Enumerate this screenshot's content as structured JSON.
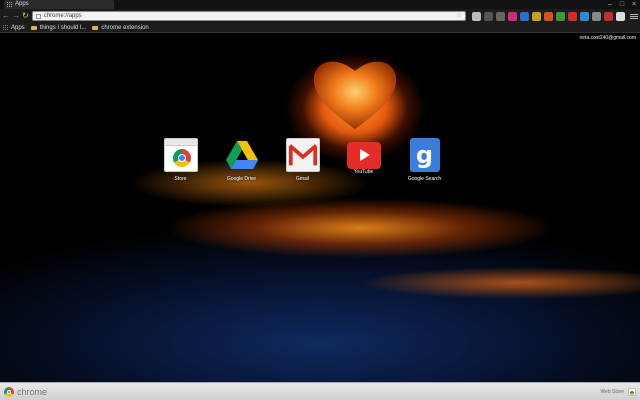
{
  "tab": {
    "title": "Apps"
  },
  "window_controls": {
    "minimize": "–",
    "maximize": "□",
    "close": "×"
  },
  "toolbar": {
    "back": "←",
    "forward": "→",
    "reload": "↻",
    "url": "chrome://apps",
    "star": "☆",
    "extensions": [
      {
        "name": "ext-icon-1",
        "color": "#bbbbbb",
        "glyph": ""
      },
      {
        "name": "ext-icon-2",
        "color": "#555555",
        "glyph": ""
      },
      {
        "name": "ext-icon-3",
        "color": "#666666",
        "glyph": ""
      },
      {
        "name": "ext-icon-4",
        "color": "#d42a7a",
        "glyph": ""
      },
      {
        "name": "ext-icon-5",
        "color": "#2a6fd4",
        "glyph": ""
      },
      {
        "name": "ext-icon-6",
        "color": "#c8a020",
        "glyph": ""
      },
      {
        "name": "ext-icon-7",
        "color": "#d85020",
        "glyph": ""
      },
      {
        "name": "ext-icon-8",
        "color": "#3a9a3a",
        "glyph": ""
      },
      {
        "name": "ext-icon-9",
        "color": "#d42a2a",
        "glyph": ""
      },
      {
        "name": "ext-icon-10",
        "color": "#2a8ad4",
        "glyph": ""
      },
      {
        "name": "ext-icon-11",
        "color": "#888888",
        "glyph": ""
      },
      {
        "name": "ext-icon-12",
        "color": "#c03030",
        "glyph": ""
      },
      {
        "name": "ext-icon-13",
        "color": "#dddddd",
        "glyph": ""
      }
    ]
  },
  "bookmarks": {
    "apps": "Apps",
    "items": [
      "things I should l...",
      "chrome extension"
    ]
  },
  "content": {
    "user_email": "neta.cost240@gmail.com",
    "apps": [
      {
        "label": "Store",
        "icon": "store-icon"
      },
      {
        "label": "Google Drive",
        "icon": "google-drive-icon"
      },
      {
        "label": "Gmail",
        "icon": "gmail-icon"
      },
      {
        "label": "YouTube",
        "icon": "youtube-icon"
      },
      {
        "label": "Google Search",
        "icon": "google-search-icon"
      }
    ]
  },
  "bottombar": {
    "brand": "chrome",
    "webstore": "Web Store"
  }
}
